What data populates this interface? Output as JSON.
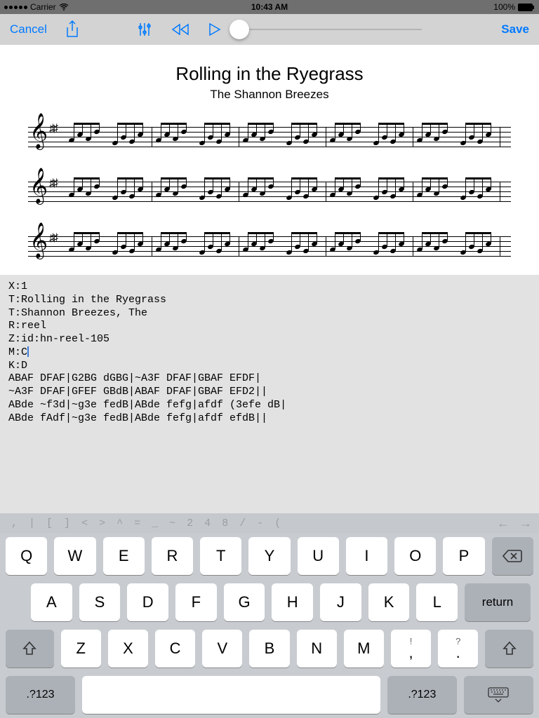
{
  "statusbar": {
    "carrier": "Carrier",
    "time": "10:43 AM",
    "battery": "100%"
  },
  "toolbar": {
    "cancel": "Cancel",
    "save": "Save"
  },
  "tune": {
    "title": "Rolling in the Ryegrass",
    "subtitle": "The Shannon Breezes"
  },
  "abc": {
    "l1": "X:1",
    "l2": "T:Rolling in the Ryegrass",
    "l3": "T:Shannon Breezes, The",
    "l4": "R:reel",
    "l5": "Z:id:hn-reel-105",
    "l6a": "M:C",
    "l7": "K:D",
    "l8": "ABAF DFAF|G2BG dGBG|~A3F DFAF|GBAF EFDF|",
    "l9": "~A3F DFAF|GFEF GBdB|ABAF DFAF|GBAF EFD2||",
    "l10": "ABde ~f3d|~g3e fedB|ABde fefg|afdf (3efe dB|",
    "l11": "ABde fAdf|~g3e fedB|ABde fefg|afdf efdB||"
  },
  "accessory": [
    ",",
    "|",
    "[",
    "]",
    "<",
    ">",
    "^",
    "=",
    "_",
    "~",
    "2",
    "4",
    "8",
    "/",
    "-",
    "("
  ],
  "rows": {
    "r1": [
      "Q",
      "W",
      "E",
      "R",
      "T",
      "Y",
      "U",
      "I",
      "O",
      "P"
    ],
    "r2": [
      "A",
      "S",
      "D",
      "F",
      "G",
      "H",
      "J",
      "K",
      "L"
    ],
    "r3": [
      "Z",
      "X",
      "C",
      "V",
      "B",
      "N",
      "M"
    ],
    "p1top": "!",
    "p1bot": ",",
    "p2top": "?",
    "p2bot": ".",
    "mode": ".?123",
    "return": "return"
  }
}
